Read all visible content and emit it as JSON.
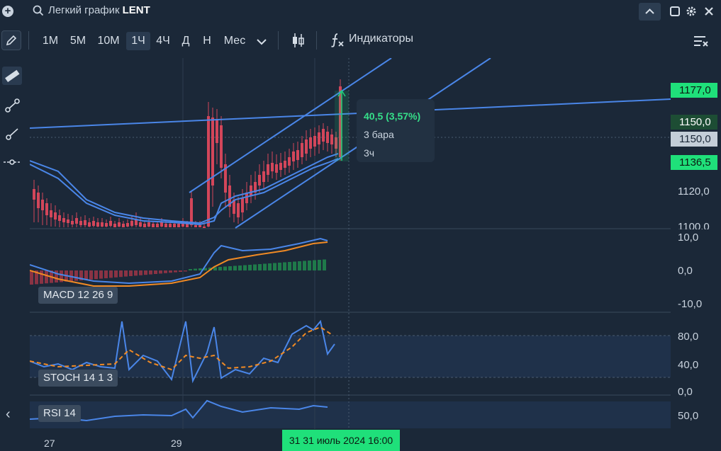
{
  "window": {
    "title_prefix": "Легкий график",
    "ticker": "LENT"
  },
  "toolbar": {
    "timeframes": [
      "1М",
      "5М",
      "10М",
      "1Ч",
      "4Ч",
      "Д",
      "Н",
      "Мес"
    ],
    "active_timeframe": "1Ч",
    "indicators_label": "Индикаторы"
  },
  "price_axis": {
    "ticks": [
      "1120,0",
      "1100,0"
    ],
    "badges": {
      "upper": "1177,0",
      "current": "1150,0",
      "current_cursor": "1150,0",
      "lower": "1136,5"
    }
  },
  "macd": {
    "label": "MACD 12 26 9",
    "ticks": [
      "10,0",
      "0,0",
      "-10,0"
    ]
  },
  "stoch": {
    "label": "STOCH 14 1 3",
    "ticks": [
      "80,0",
      "40,0",
      "0,0"
    ]
  },
  "rsi": {
    "label": "RSI 14",
    "ticks": [
      "50,0"
    ]
  },
  "measure_tooltip": {
    "change": "40,5 (3,57%)",
    "bars": "3 бара",
    "duration": "3ч"
  },
  "time_axis": {
    "labels": [
      "27",
      "29",
      "31"
    ],
    "cursor": "31 июль 2024 16:00"
  },
  "colors": {
    "background": "#1b2838",
    "up": "#1fd07a",
    "down": "#d3465a",
    "line_blue": "#4a86e8",
    "signal_orange": "#f08a24"
  },
  "chart_data": {
    "type": "candlestick",
    "price_axis_visible_range": [
      1095,
      1190
    ],
    "annotations": [
      "40,5 (3,57%)",
      "3 бара",
      "3ч"
    ]
  }
}
